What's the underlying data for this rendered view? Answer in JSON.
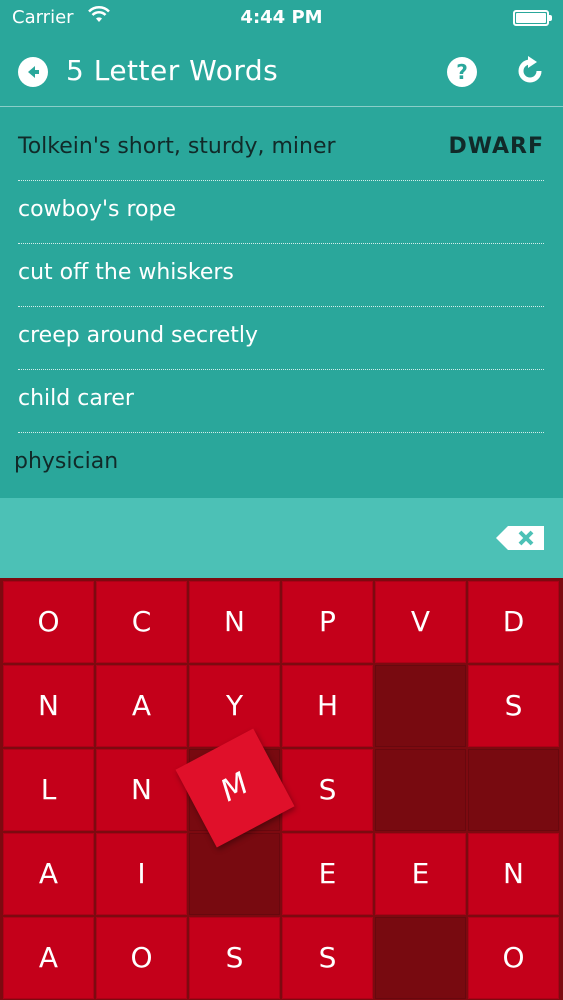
{
  "status": {
    "carrier": "Carrier",
    "time": "4:44 PM"
  },
  "nav": {
    "title": "5 Letter Words",
    "help_label": "?"
  },
  "clues": [
    {
      "text": "Tolkein's short, sturdy, miner",
      "answer": "DWARF"
    },
    {
      "text": "cowboy's rope",
      "answer": ""
    },
    {
      "text": "cut off the whiskers",
      "answer": ""
    },
    {
      "text": "creep around secretly",
      "answer": ""
    },
    {
      "text": "child carer",
      "answer": ""
    },
    {
      "text": "physician",
      "answer": ""
    }
  ],
  "board": {
    "rows": [
      [
        "O",
        "C",
        "N",
        "P",
        "V",
        "D"
      ],
      [
        "N",
        "A",
        "Y",
        "H",
        "",
        "S"
      ],
      [
        "L",
        "N",
        "",
        "S",
        "",
        ""
      ],
      [
        "A",
        "I",
        "",
        "E",
        "E",
        "N"
      ],
      [
        "A",
        "O",
        "S",
        "S",
        "",
        "O"
      ]
    ],
    "floating_tile": "M"
  },
  "colors": {
    "teal": "#2aa79b",
    "input_strip": "#4cc1b6",
    "tile": "#c4001a",
    "board": "#7d0a10"
  }
}
